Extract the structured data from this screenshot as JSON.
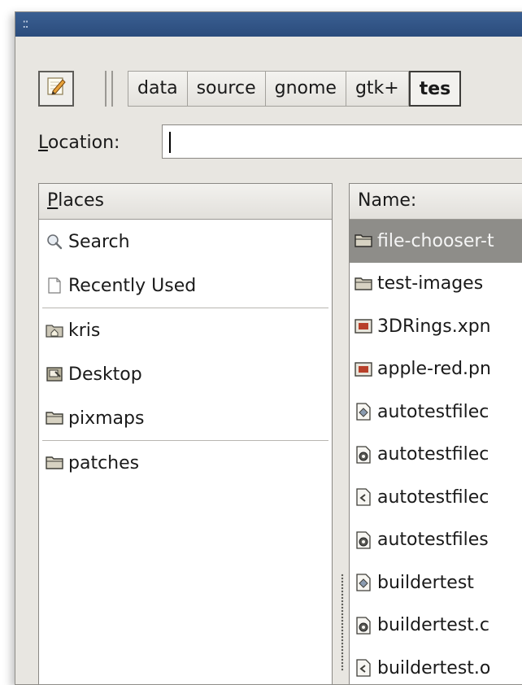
{
  "window": {
    "title_grip": "::"
  },
  "path_bar": {
    "edit_button_icon": "pencil-icon",
    "crumbs": [
      "data",
      "source",
      "gnome",
      "gtk+",
      "tes"
    ],
    "active_index": 4
  },
  "location": {
    "label_prefix": "L",
    "label_rest": "ocation:",
    "value": ""
  },
  "places": {
    "header_prefix": "P",
    "header_rest": "laces",
    "items": [
      {
        "label": "Search",
        "icon": "magnifier-icon"
      },
      {
        "label": "Recently Used",
        "icon": "document-icon"
      },
      {
        "label": "kris",
        "icon": "home-folder-icon"
      },
      {
        "label": "Desktop",
        "icon": "desktop-icon"
      },
      {
        "label": "pixmaps",
        "icon": "folder-icon"
      },
      {
        "label": "patches",
        "icon": "folder-icon"
      }
    ]
  },
  "files": {
    "header": "Name:",
    "items": [
      {
        "label": "file-chooser-t",
        "icon": "folder-icon",
        "selected": true
      },
      {
        "label": "test-images",
        "icon": "folder-icon"
      },
      {
        "label": "3DRings.xpn",
        "icon": "image-icon"
      },
      {
        "label": "apple-red.pn",
        "icon": "image-icon"
      },
      {
        "label": "autotestfilec",
        "icon": "executable-icon"
      },
      {
        "label": "autotestfilec",
        "icon": "gear-file-icon"
      },
      {
        "label": "autotestfilec",
        "icon": "source-file-icon"
      },
      {
        "label": "autotestfiles",
        "icon": "gear-file-icon"
      },
      {
        "label": "buildertest",
        "icon": "executable-icon"
      },
      {
        "label": "buildertest.c",
        "icon": "gear-file-icon"
      },
      {
        "label": "buildertest.o",
        "icon": "source-file-icon"
      }
    ]
  }
}
